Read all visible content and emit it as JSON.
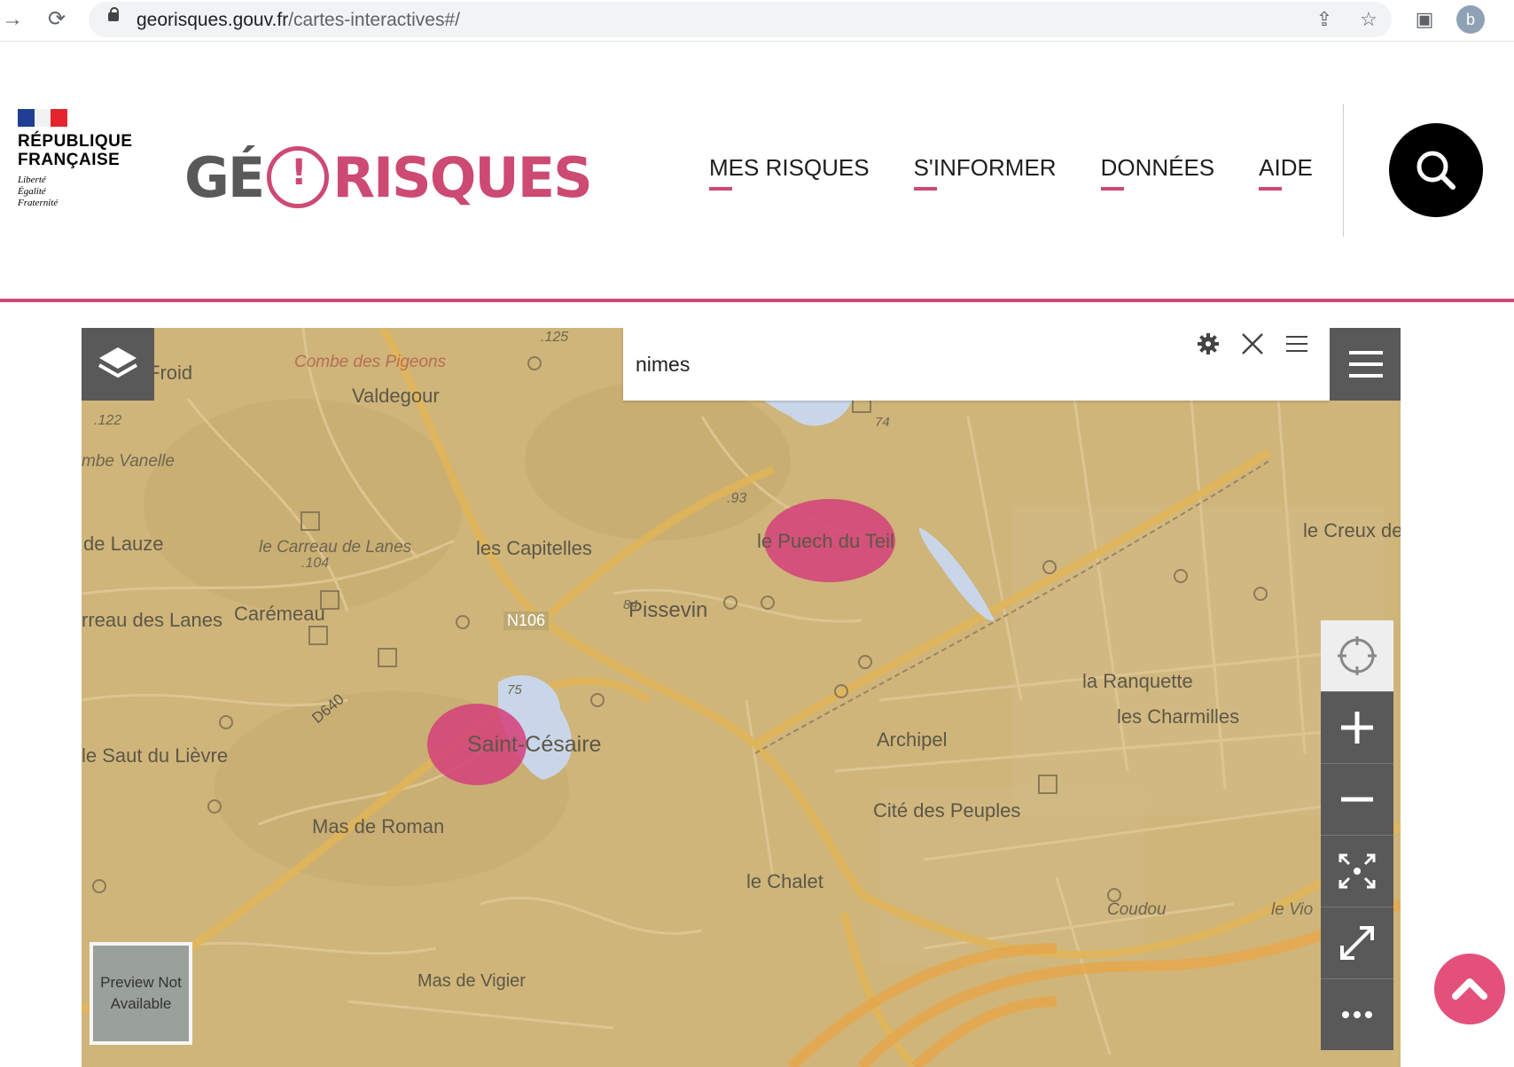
{
  "browser": {
    "url_domain": "georisques.gouv.fr",
    "url_path": "/cartes-interactives#/",
    "avatar_letter": "b"
  },
  "header": {
    "rf_name_line1": "RÉPUBLIQUE",
    "rf_name_line2": "FRANÇAISE",
    "motto_1": "Liberté",
    "motto_2": "Égalité",
    "motto_3": "Fraternité",
    "logo_left": "GÉ",
    "logo_right": "RISQUES",
    "nav": [
      "MES RISQUES",
      "S'INFORMER",
      "DONNÉES",
      "AIDE"
    ]
  },
  "map": {
    "search_value": "nimes",
    "preview_text": "Preview Not Available",
    "labels": {
      "froid": "Froid",
      "combe_pigeons": "Combe des Pigeons",
      "valdegour": "Valdegour",
      "combe_vanelle": "mbe Vanelle",
      "de_lauze": "de Lauze",
      "carreau": "le Carreau de Lanes",
      "capitelles": "les Capitelles",
      "puech": "le Puech du Teil",
      "creux": "le Creux de",
      "pissevin": "Pissevin",
      "carremeau": "Carémeau",
      "rreau_lanes": "rreau des Lanes",
      "n106": "N106",
      "ranquette": "la Ranquette",
      "charmilles": "les Charmilles",
      "archipel": "Archipel",
      "saint_cesaire": "Saint-Césaire",
      "saut_lievre": "le Saut du Lièvre",
      "d640": "D640",
      "cite_peuples": "Cité des Peuples",
      "mas_roman": "Mas de Roman",
      "le_chalet": "le Chalet",
      "coudou": "Coudou",
      "le_vio": "le Vio",
      "mas_vigier": "Mas de Vigier",
      "alt_125": ".125",
      "alt_122": ".122",
      "alt_93": ".93",
      "alt_84": "84",
      "alt_104": ".104",
      "alt_74": "74",
      "alt_75": "75"
    },
    "colors": {
      "base": "#cfb57a",
      "road_major": "#e0b55a",
      "risk_zone": "#d4407a",
      "water": "#c9d6ea"
    }
  }
}
